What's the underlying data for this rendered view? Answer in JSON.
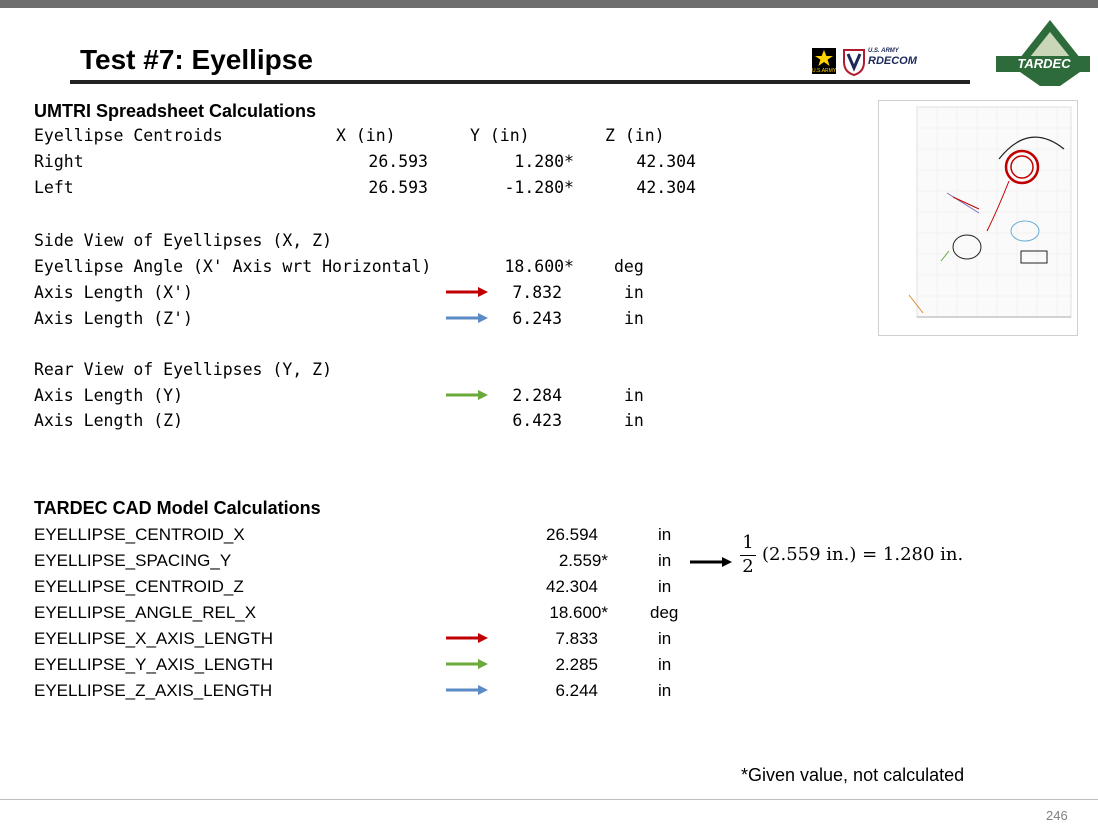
{
  "slide": {
    "title": "Test #7: Eyellipse",
    "page_number": "246",
    "note": "*Given value, not calculated"
  },
  "logos": {
    "rdecom_small": "U.S. ARMY",
    "rdecom": "RDECOM",
    "army_small": "U.S.ARMY",
    "tardec": "TARDEC"
  },
  "umtri": {
    "heading": "UMTRI Spreadsheet Calculations",
    "centroids_label": "Eyellipse Centroids",
    "col_x": "X (in)",
    "col_y": "Y (in)",
    "col_z": "Z (in)",
    "rows": [
      {
        "label": "Right",
        "x": "26.593",
        "y": "1.280*",
        "z": "42.304"
      },
      {
        "label": "Left",
        "x": "26.593",
        "y": "-1.280*",
        "z": "42.304"
      }
    ],
    "side_view": {
      "heading": "Side View of Eyellipses (X, Z)",
      "angle_label": "Eyellipse Angle (X' Axis wrt Horizontal)",
      "angle_value": "18.600*",
      "angle_unit": "deg",
      "axis_x_label": "Axis Length (X')",
      "axis_x_value": "7.832",
      "axis_x_unit": "in",
      "axis_z_label": "Axis Length (Z')",
      "axis_z_value": "6.243",
      "axis_z_unit": "in"
    },
    "rear_view": {
      "heading": "Rear View of Eyellipses (Y, Z)",
      "axis_y_label": "Axis Length (Y)",
      "axis_y_value": "2.284",
      "axis_y_unit": "in",
      "axis_z_label": "Axis Length (Z)",
      "axis_z_value": "6.423",
      "axis_z_unit": "in"
    }
  },
  "cad": {
    "heading": "TARDEC CAD Model Calculations",
    "rows": [
      {
        "label": "EYELLIPSE_CENTROID_X",
        "value": "26.594",
        "unit": "in"
      },
      {
        "label": "EYELLIPSE_SPACING_Y",
        "value": "2.559*",
        "unit": "in"
      },
      {
        "label": "EYELLIPSE_CENTROID_Z",
        "value": "42.304",
        "unit": "in"
      },
      {
        "label": "EYELLIPSE_ANGLE_REL_X",
        "value": "18.600*",
        "unit": "deg"
      },
      {
        "label": "EYELLIPSE_X_AXIS_LENGTH",
        "value": "7.833",
        "unit": "in"
      },
      {
        "label": "EYELLIPSE_Y_AXIS_LENGTH",
        "value": "2.285",
        "unit": "in"
      },
      {
        "label": "EYELLIPSE_Z_AXIS_LENGTH",
        "value": "6.244",
        "unit": "in"
      }
    ],
    "formula": {
      "numerator": "1",
      "denominator": "2",
      "expression": "(2.559 in.) = 1.280 in."
    }
  },
  "colors": {
    "red_arrow": "#c00000",
    "blue_arrow": "#5b8bc4",
    "green_arrow": "#6aaa3a",
    "title_rule": "#222222",
    "top_bar": "#6e6e6e"
  },
  "icons": [
    "army-star-logo",
    "rdecom-shield-logo",
    "tardec-logo",
    "arrow-right-icon",
    "plot-thumbnail"
  ]
}
